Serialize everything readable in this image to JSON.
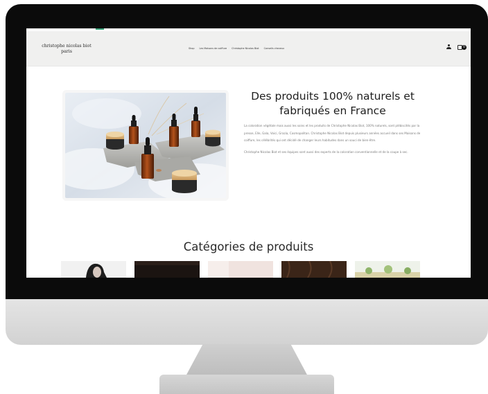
{
  "header": {
    "logo_line1": "christophe nicolas biot",
    "logo_line2": "paris",
    "nav": [
      "Shop",
      "Les Maisons de coiffure",
      "Christophe Nicolas Biot",
      "Conseils cheveux"
    ],
    "cart_count": "0"
  },
  "hero": {
    "title": "Des produits 100% naturels et fabriqués en France",
    "paragraph1": "La coloration végétale mais aussi les soins et les produits de Christophe Nicolas Biot, 100% naturels, sont plébiscités par la presse, Elle, Gala, Voici, Grazia, Cosmopolitan. Christophe Nicolas Biot depuis plusieurs années accueil dans ses Maisons de coiffure, les célébrités qui ont décidé de changer leurs habitudes dans un souci de bien-être.",
    "paragraph2": "Christophe Nicolas Biot et ses équipes sont aussi des experts de la coloration conventionnelle et de la coupe à sec."
  },
  "categories": {
    "title": "Catégories de produits"
  },
  "icons": {
    "account": "user-icon",
    "cart": "shopping-bag-icon"
  },
  "colors": {
    "header_bg": "#f0f0ef",
    "text": "#1e1e1e",
    "accent": "#3aa37a"
  }
}
